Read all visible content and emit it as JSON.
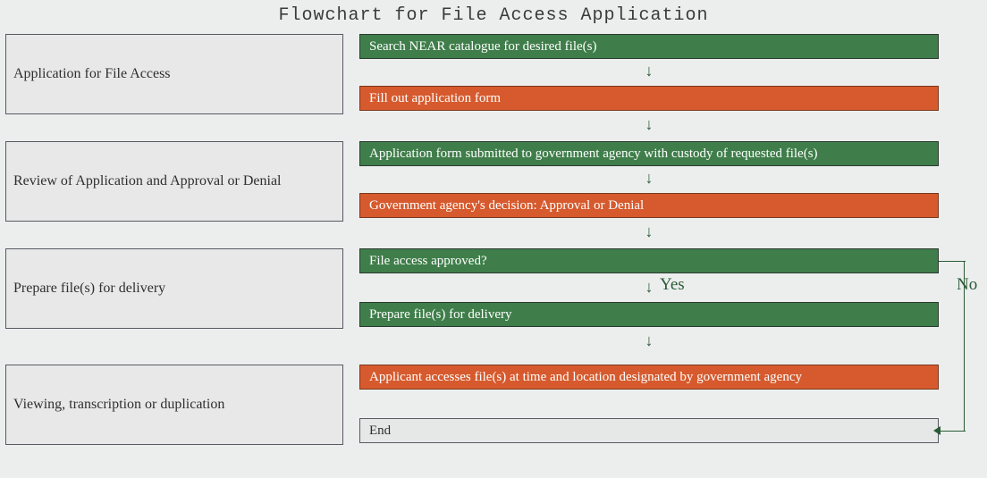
{
  "title": "Flowchart for File Access Application",
  "stages": [
    {
      "label": "Application for File Access"
    },
    {
      "label": "Review of Application and Approval or Denial"
    },
    {
      "label": "Prepare file(s) for delivery"
    },
    {
      "label": "Viewing, transcription or duplication"
    }
  ],
  "steps": [
    {
      "text": "Search NEAR catalogue for desired file(s)"
    },
    {
      "text": "Fill out application form"
    },
    {
      "text": "Application form submitted to government agency with custody of requested file(s)"
    },
    {
      "text": "Government agency's decision: Approval or Denial"
    },
    {
      "text": "File access approved?"
    },
    {
      "text": "Prepare file(s) for delivery"
    },
    {
      "text": "Applicant accesses file(s) at time and location designated by government agency"
    },
    {
      "text": "End"
    }
  ],
  "branch": {
    "yes": "Yes",
    "no": "No"
  }
}
